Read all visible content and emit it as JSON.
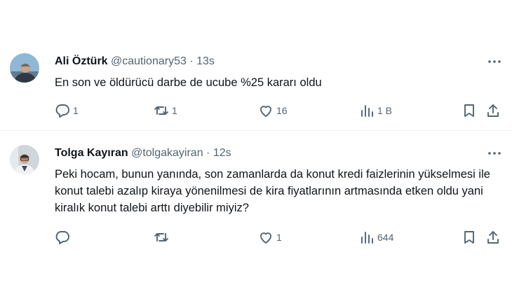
{
  "tweets": [
    {
      "author": "Ali Öztürk",
      "handle": "@cautionary53",
      "separator": "·",
      "time": "13s",
      "text": "En son ve öldürücü darbe de ucube %25 kararı oldu",
      "replies": "1",
      "retweets": "1",
      "likes": "16",
      "views": "1 B",
      "avatar_colors": {
        "bg": "#8fb7d6",
        "face": "#c9a48a",
        "shirt": "#2f3945"
      }
    },
    {
      "author": "Tolga Kayıran",
      "handle": "@tolgakayiran",
      "separator": "·",
      "time": "12s",
      "text": "Peki hocam, bunun yanında, son zamanlarda da konut kredi faizlerinin yükselmesi ile konut talebi azalıp kiraya yönenilmesi de kira fiyatlarının artmasında etken oldu yani kiralık konut talebi arttı diyebilir miyiz?",
      "replies": "",
      "retweets": "",
      "likes": "1",
      "views": "644",
      "avatar_colors": {
        "bg": "#cfd6dc",
        "face": "#d2a88e",
        "shirt": "#f2f2f2"
      }
    }
  ],
  "icons": {
    "reply": "reply-icon",
    "retweet": "retweet-icon",
    "like": "heart-icon",
    "views": "views-icon",
    "bookmark": "bookmark-icon",
    "share": "share-icon",
    "more": "more-icon"
  },
  "colors": {
    "text": "#0f1419",
    "secondary": "#536471",
    "divider": "#eff3f4"
  }
}
